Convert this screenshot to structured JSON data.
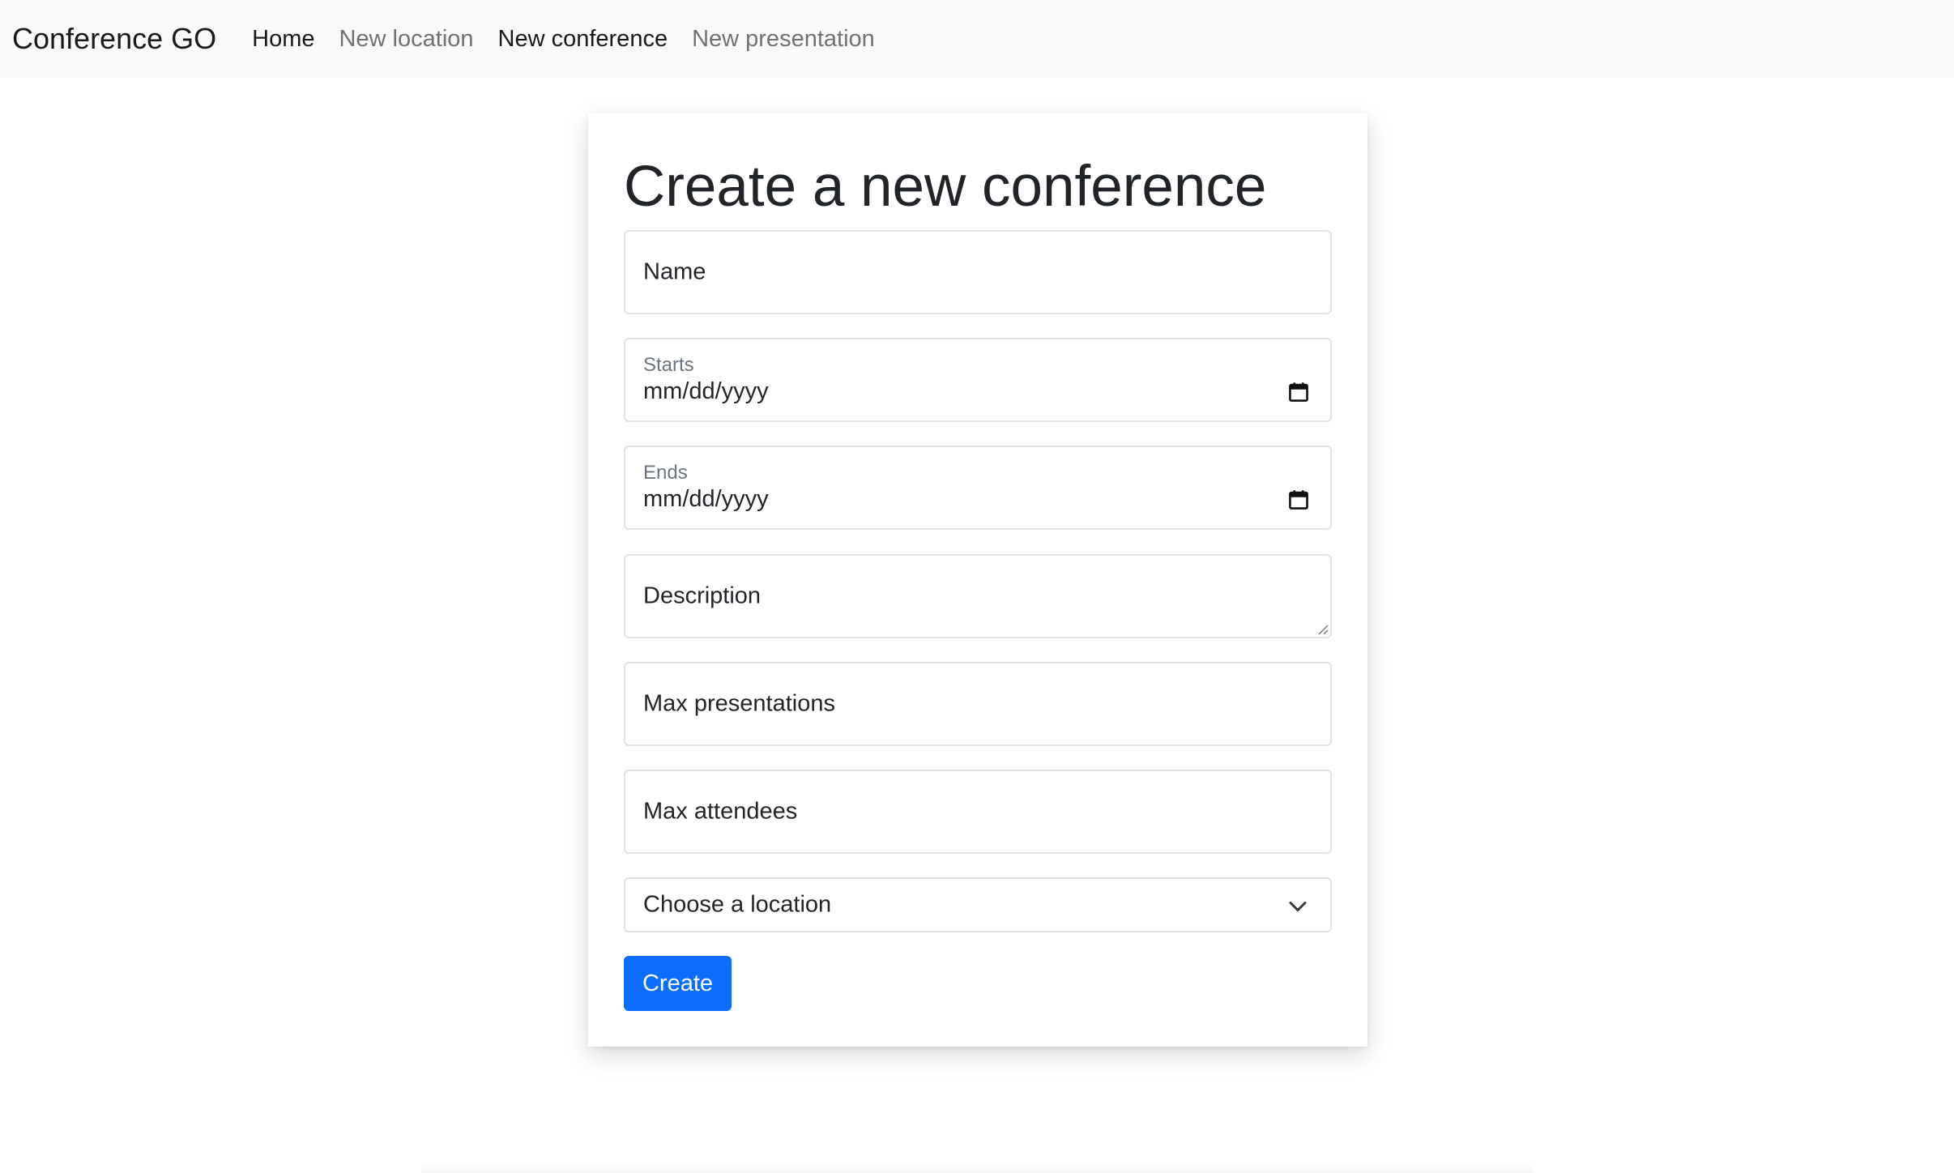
{
  "navbar": {
    "brand": "Conference GO",
    "links": [
      {
        "label": "Home",
        "active": true
      },
      {
        "label": "New location",
        "active": false
      },
      {
        "label": "New conference",
        "active": true
      },
      {
        "label": "New presentation",
        "active": false
      }
    ]
  },
  "form": {
    "title": "Create a new conference",
    "name": {
      "placeholder": "Name",
      "value": ""
    },
    "starts": {
      "label": "Starts",
      "value": "mm/dd/yyyy",
      "icon": "calendar-icon"
    },
    "ends": {
      "label": "Ends",
      "value": "mm/dd/yyyy",
      "icon": "calendar-icon"
    },
    "description": {
      "placeholder": "Description",
      "value": ""
    },
    "max_presentations": {
      "placeholder": "Max presentations",
      "value": ""
    },
    "max_attendees": {
      "placeholder": "Max attendees",
      "value": ""
    },
    "location": {
      "selected": "Choose a location",
      "icon": "chevron-down-icon"
    },
    "submit_label": "Create"
  },
  "colors": {
    "primary": "#0d6efd",
    "navbar_bg": "#f8f9fa",
    "border": "#dee2e6",
    "muted_text": "#6c757d"
  }
}
